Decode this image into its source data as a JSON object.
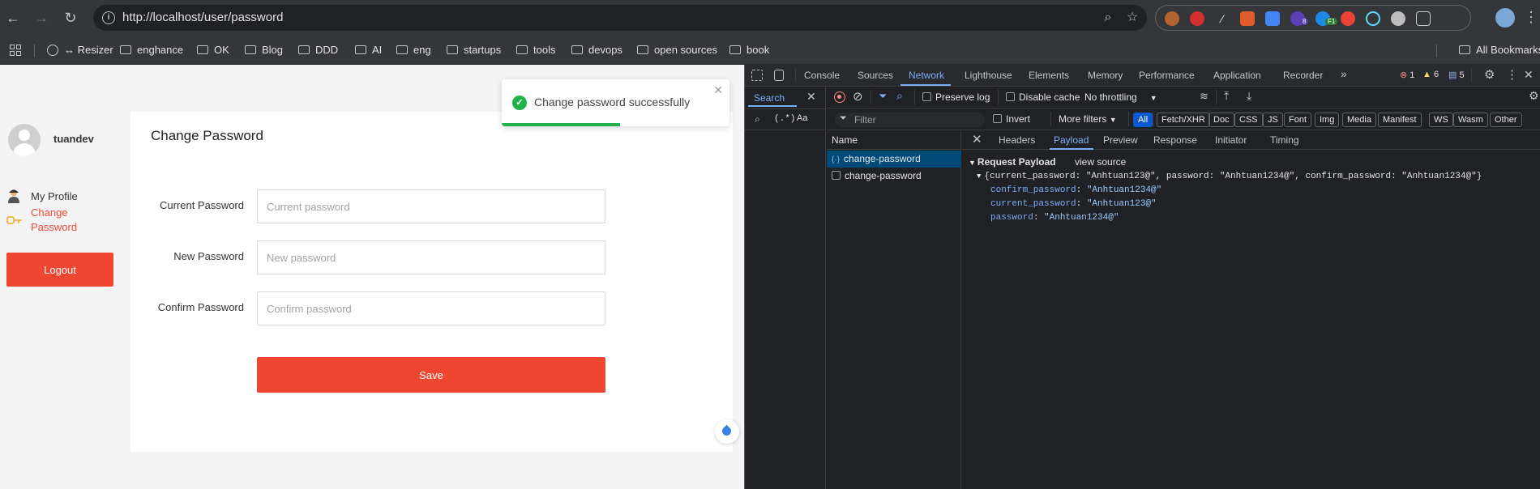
{
  "browser": {
    "url": "http://localhost/user/password",
    "bookmarks": [
      "Resizer",
      "enghance",
      "OK",
      "Blog",
      "DDD",
      "AI",
      "eng",
      "startups",
      "tools",
      "devops",
      "open sources",
      "book"
    ],
    "all_bookmarks": "All Bookmarks",
    "resizer_prefix": "↔",
    "extension_badges": [
      "8",
      "F1"
    ]
  },
  "app": {
    "username": "tuandev",
    "nav": {
      "my_profile": "My Profile",
      "change_password": "Change Password"
    },
    "logout_label": "Logout",
    "card_title": "Change Password",
    "fields": [
      {
        "label": "Current Password",
        "placeholder": "Current password"
      },
      {
        "label": "New Password",
        "placeholder": "New password"
      },
      {
        "label": "Confirm Password",
        "placeholder": "Confirm password"
      }
    ],
    "save_label": "Save",
    "toast": {
      "message": "Change password successfully",
      "progress_fraction": 0.52
    },
    "accent_color": "#ee4631",
    "success_color": "#22b24c"
  },
  "devtools": {
    "tabs": [
      "Console",
      "Sources",
      "Network",
      "Lighthouse",
      "Elements",
      "Memory",
      "Performance",
      "Application",
      "Recorder"
    ],
    "active_tab": "Network",
    "errors": "1",
    "warnings": "6",
    "issues": "5",
    "search_tab": "Search",
    "search_options": [
      "(.*)",
      "Aa"
    ],
    "toolbar": {
      "preserve_log": "Preserve log",
      "disable_cache": "Disable cache",
      "throttling": "No throttling"
    },
    "filter": {
      "placeholder": "Filter",
      "invert": "Invert",
      "more_filters": "More filters",
      "types": [
        "All",
        "Fetch/XHR",
        "Doc",
        "CSS",
        "JS",
        "Font",
        "Img",
        "Media",
        "Manifest",
        "WS",
        "Wasm",
        "Other"
      ]
    },
    "requests_header": "Name",
    "requests": [
      "change-password",
      "change-password"
    ],
    "detail_tabs": [
      "Headers",
      "Payload",
      "Preview",
      "Response",
      "Initiator",
      "Timing"
    ],
    "payload": {
      "title": "Request Payload",
      "view_source": "view source",
      "summary": "{current_password: \"Anhtuan123@\", password: \"Anhtuan1234@\", confirm_password: \"Anhtuan1234@\"}",
      "entries": [
        {
          "key": "confirm_password",
          "value": "\"Anhtuan1234@\""
        },
        {
          "key": "current_password",
          "value": "\"Anhtuan123@\""
        },
        {
          "key": "password",
          "value": "\"Anhtuan1234@\""
        }
      ]
    }
  }
}
